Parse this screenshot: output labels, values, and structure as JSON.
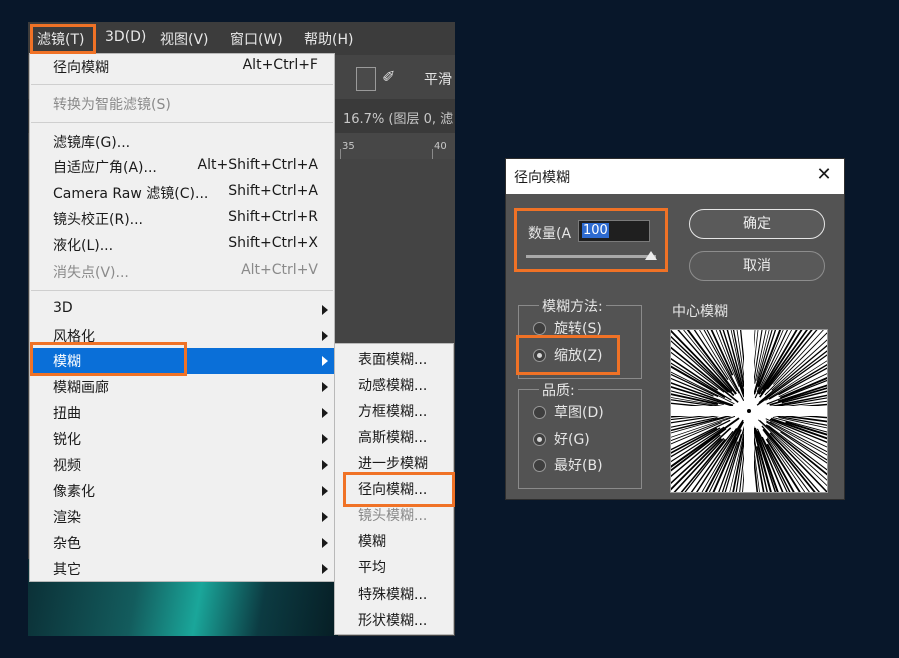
{
  "menubar": {
    "items": [
      "滤镜(T)",
      "3D(D)",
      "视图(V)",
      "窗口(W)",
      "帮助(H)"
    ]
  },
  "options_bar": {
    "smooth_label": "平滑"
  },
  "document_tab": {
    "text": "16.7% (图层 0, 滤"
  },
  "ruler": {
    "labels": [
      "35",
      "40"
    ]
  },
  "filter_menu": {
    "items": [
      {
        "label": "径向模糊",
        "shortcut": "Alt+Ctrl+F"
      },
      {
        "label": "转换为智能滤镜(S)",
        "disabled": true
      },
      {
        "label": "滤镜库(G)..."
      },
      {
        "label": "自适应广角(A)...",
        "shortcut": "Alt+Shift+Ctrl+A"
      },
      {
        "label": "Camera Raw 滤镜(C)...",
        "shortcut": "Shift+Ctrl+A"
      },
      {
        "label": "镜头校正(R)...",
        "shortcut": "Shift+Ctrl+R"
      },
      {
        "label": "液化(L)...",
        "shortcut": "Shift+Ctrl+X"
      },
      {
        "label": "消失点(V)...",
        "shortcut": "Alt+Ctrl+V",
        "disabled": true
      },
      {
        "label": "3D"
      },
      {
        "label": "风格化"
      },
      {
        "label": "模糊"
      },
      {
        "label": "模糊画廊"
      },
      {
        "label": "扭曲"
      },
      {
        "label": "锐化"
      },
      {
        "label": "视频"
      },
      {
        "label": "像素化"
      },
      {
        "label": "渲染"
      },
      {
        "label": "杂色"
      },
      {
        "label": "其它"
      }
    ]
  },
  "blur_submenu": {
    "items": [
      "表面模糊...",
      "动感模糊...",
      "方框模糊...",
      "高斯模糊...",
      "进一步模糊",
      "径向模糊...",
      "镜头模糊...",
      "模糊",
      "平均",
      "特殊模糊...",
      "形状模糊..."
    ]
  },
  "dialog": {
    "title": "径向模糊",
    "amount_label": "数量(A",
    "amount_value": "100",
    "amount_max": 100,
    "ok_label": "确定",
    "cancel_label": "取消",
    "blur_method": {
      "title": "模糊方法:",
      "options": [
        "旋转(S)",
        "缩放(Z)"
      ],
      "selected": "缩放(Z)"
    },
    "quality": {
      "title": "品质:",
      "options": [
        "草图(D)",
        "好(G)",
        "最好(B)"
      ],
      "selected": "好(G)"
    },
    "center_label": "中心模糊"
  },
  "colors": {
    "highlight_box": "#f07226",
    "menu_selection": "#0a6fd8",
    "dialog_bg": "#535353",
    "background": "#08172a"
  }
}
